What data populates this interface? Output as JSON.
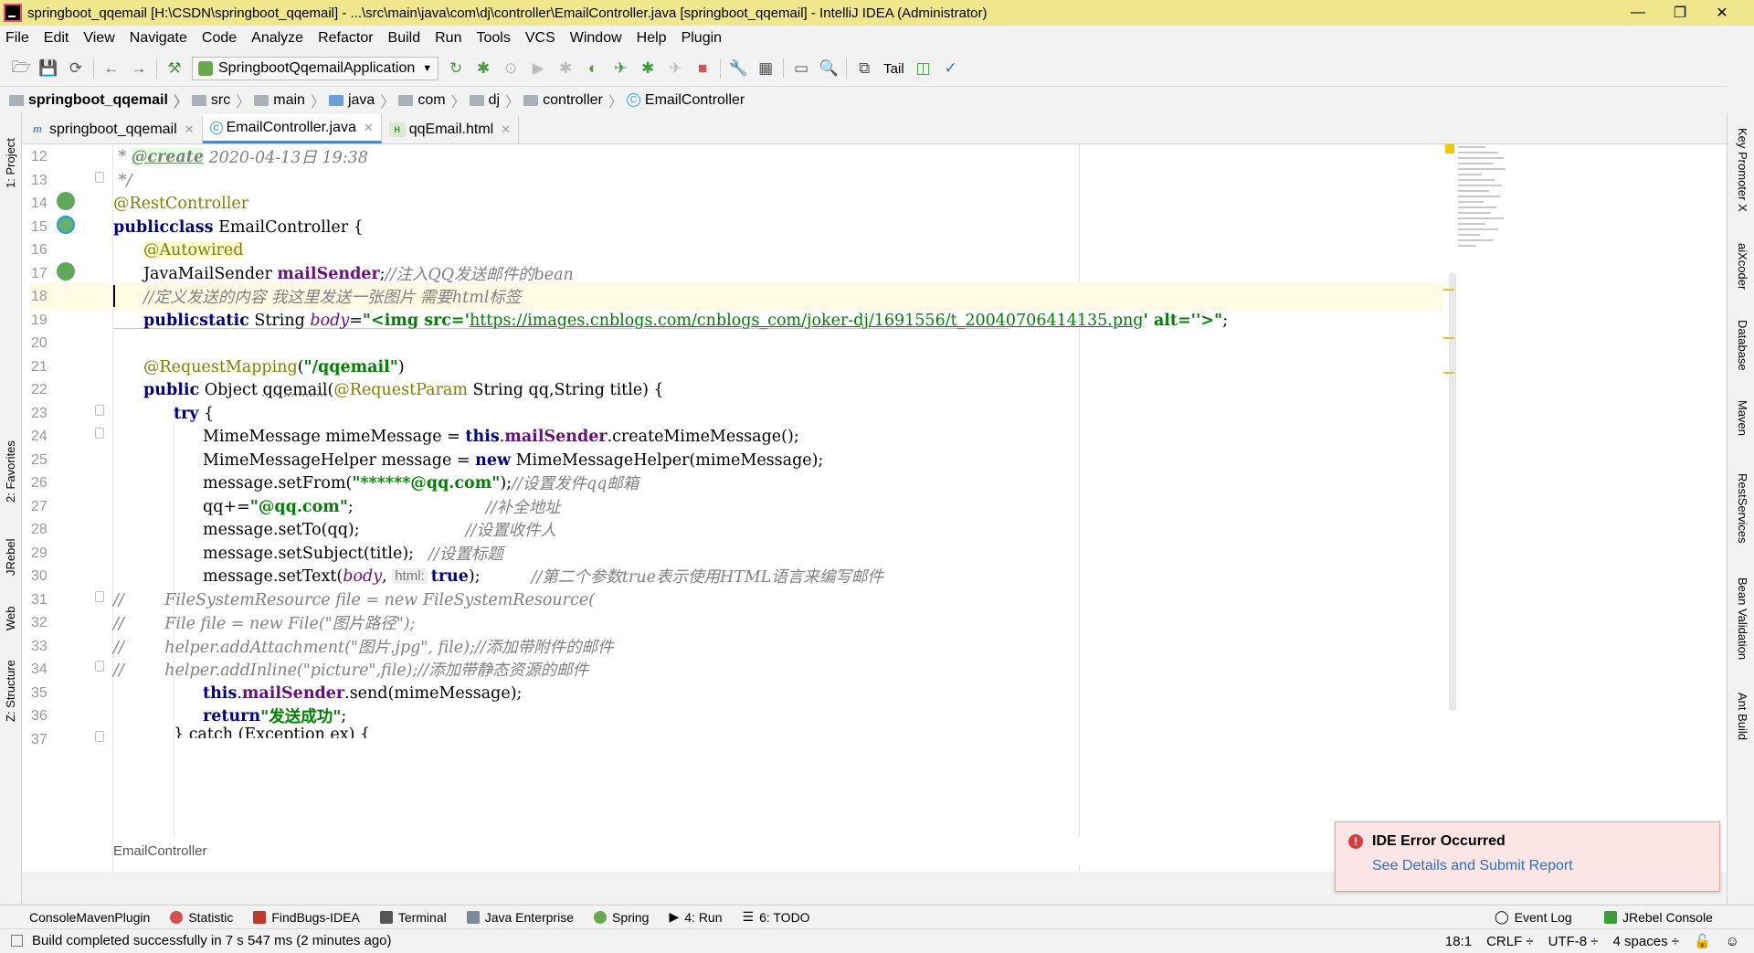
{
  "window": {
    "title": "springboot_qqemail [H:\\CSDN\\springboot_qqemail] - ...\\src\\main\\java\\com\\dj\\controller\\EmailController.java [springboot_qqemail] - IntelliJ IDEA (Administrator)",
    "controls": {
      "minimize": "—",
      "maximize": "❐",
      "close": "✕"
    }
  },
  "menu": [
    "File",
    "Edit",
    "View",
    "Navigate",
    "Code",
    "Analyze",
    "Refactor",
    "Build",
    "Run",
    "Tools",
    "VCS",
    "Window",
    "Help",
    "Plugin"
  ],
  "toolbar": {
    "run_config": "SpringbootQqemailApplication",
    "tail": "Tail"
  },
  "breadcrumbs": [
    "springboot_qqemail",
    "src",
    "main",
    "java",
    "com",
    "dj",
    "controller",
    "EmailController"
  ],
  "tabs": [
    {
      "label": "springboot_qqemail",
      "icon": "m",
      "active": false
    },
    {
      "label": "EmailController.java",
      "icon": "c",
      "active": true
    },
    {
      "label": "qqEmail.html",
      "icon": "h",
      "active": false
    }
  ],
  "left_tools": [
    "1: Project",
    "2: Favorites",
    "JRebel",
    "Web",
    "Z: Structure"
  ],
  "right_tools": [
    "Key Promoter X",
    "aiXcoder",
    "Database",
    "Maven",
    "RestServices",
    "Bean Validation",
    "Ant Build"
  ],
  "editor": {
    "current_line": 18,
    "breadcrumb": "EmailController",
    "line_numbers": [
      "12",
      "13",
      "14",
      "15",
      "16",
      "17",
      "18",
      "19",
      "20",
      "21",
      "22",
      "23",
      "24",
      "25",
      "26",
      "27",
      "28",
      "29",
      "30",
      "31",
      "32",
      "33",
      "34",
      "35",
      "36",
      "37"
    ],
    "code": {
      "l12_star": " * ",
      "l12_tag": "@create",
      "l12_rest": " 2020-04-13日 19:38",
      "l13": " */",
      "l14": "@RestController",
      "l15_kw1": "public",
      "l15_kw2": "class",
      "l15_rest": " EmailController {",
      "l16": "@Autowired",
      "l17_type": "JavaMailSender ",
      "l17_field": "mailSender",
      "l17_semi": ";",
      "l17_cmt": "//注入QQ发送邮件的bean",
      "l18_cmt": "//定义发送的内容 我这里发送一张图片 需要html标签",
      "l19_kw1": "public",
      "l19_kw2": "static",
      "l19_type": " String ",
      "l19_field": "body",
      "l19_eq": "=",
      "l19_str1": "\"<img src='",
      "l19_link": "https://images.cnblogs.com/cnblogs_com/joker-dj/1691556/t_20040706414135.png",
      "l19_str2": "' alt=''>\"",
      "l19_end": ";",
      "l21_ann": "@RequestMapping",
      "l21_paren1": "(",
      "l21_str": "\"/qqemail\"",
      "l21_paren2": ")",
      "l22_kw": "public",
      "l22_type": " Object ",
      "l22_method": "qqemail",
      "l22_p1": "(",
      "l22_ann": "@RequestParam",
      "l22_rest": " String qq,String title) {",
      "l23_kw": "try",
      "l23_rest": " {",
      "l24_a": "MimeMessage mimeMessage = ",
      "l24_kw": "this",
      "l24_dot": ".",
      "l24_field": "mailSender",
      "l24_rest": ".createMimeMessage();",
      "l25_a": "MimeMessageHelper message = ",
      "l25_kw": "new",
      "l25_rest": " MimeMessageHelper(mimeMessage);",
      "l26_a": "message.setFrom(",
      "l26_str": "\"******@qq.com\"",
      "l26_b": ");",
      "l26_cmt": "//设置发件qq邮箱",
      "l27_a": "qq+=",
      "l27_str": "\"@qq.com\"",
      "l27_b": ";",
      "l27_cmt": "//补全地址",
      "l28_a": "message.setTo(qq);",
      "l28_cmt": "//设置收件人",
      "l29_a": "message.setSubject(title);",
      "l29_cmt": "//设置标题",
      "l30_a": "message.setText(",
      "l30_body": "body",
      "l30_comma": ", ",
      "l30_hint": "html:",
      "l30_true": "true",
      "l30_b": ");",
      "l30_cmt": "//第二个参数true表示使用HTML语言来编写邮件",
      "l31": "//        FileSystemResource file = new FileSystemResource(",
      "l32": "//        File file = new File(\"图片路径\");",
      "l33": "//        helper.addAttachment(\"图片.jpg\", file);//添加带附件的邮件",
      "l34": "//        helper.addInline(\"picture\",file);//添加带静态资源的邮件",
      "l35_kw": "this",
      "l35_dot": ".",
      "l35_field": "mailSender",
      "l35_rest": ".send(mimeMessage);",
      "l36_kw": "return",
      "l36_str": "\"发送成功\"",
      "l36_end": ";",
      "l37": "} catch (Exception ex) {"
    }
  },
  "error_popup": {
    "title": "IDE Error Occurred",
    "link": "See Details and Submit Report"
  },
  "bottom_tools": [
    "ConsoleMavenPlugin",
    "Statistic",
    "FindBugs-IDEA",
    "Terminal",
    "Java Enterprise",
    "Spring",
    "4: Run",
    "6: TODO",
    "Event Log",
    "JRebel Console"
  ],
  "status": {
    "message": "Build completed successfully in 7 s 547 ms (2 minutes ago)",
    "position": "18:1",
    "line_sep": "CRLF ÷",
    "encoding": "UTF-8 ÷",
    "indent": "4 spaces ÷"
  }
}
